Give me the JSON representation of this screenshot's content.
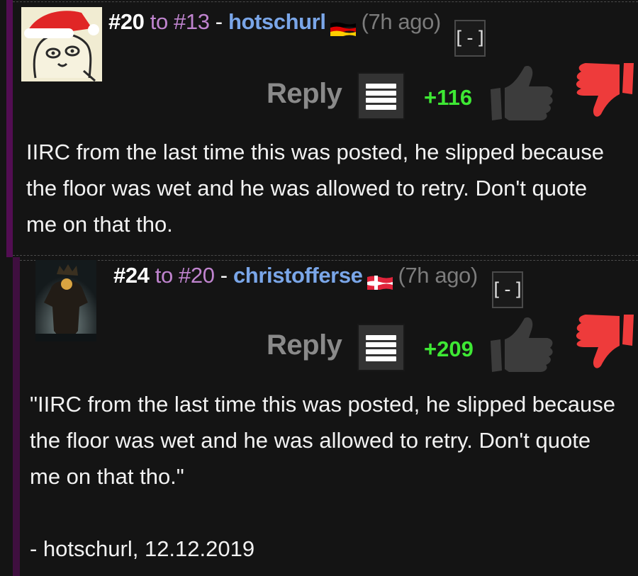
{
  "comments": [
    {
      "number": "#20",
      "to_word": "to",
      "parent": "#13",
      "separator": "-",
      "username": "hotschurl",
      "flag": "germany-flag-icon",
      "time": "(7h ago)",
      "collapse_label": "[-]",
      "reply_label": "Reply",
      "score": "+116",
      "body": "IIRC from the last time this was posted, he slipped because the floor was wet and he was allowed to retry. Don't quote me on that tho."
    },
    {
      "number": "#24",
      "to_word": "to",
      "parent": "#20",
      "separator": "-",
      "username": "christofferse",
      "flag": "denmark-flag-icon",
      "time": "(7h ago)",
      "collapse_label": "[-]",
      "reply_label": "Reply",
      "score": "+209",
      "body": "\"IIRC from the last time this was posted, he slipped because the floor was wet and he was allowed to retry. Don't quote me on that tho.\"",
      "signature": "- hotschurl, 12.12.2019"
    }
  ],
  "colors": {
    "background": "#141414",
    "username": "#7aa6e8",
    "reply_link": "#c084cf",
    "score": "#3ee834",
    "downvote": "#ee3b3b",
    "upvote": "#3c3c3c"
  }
}
